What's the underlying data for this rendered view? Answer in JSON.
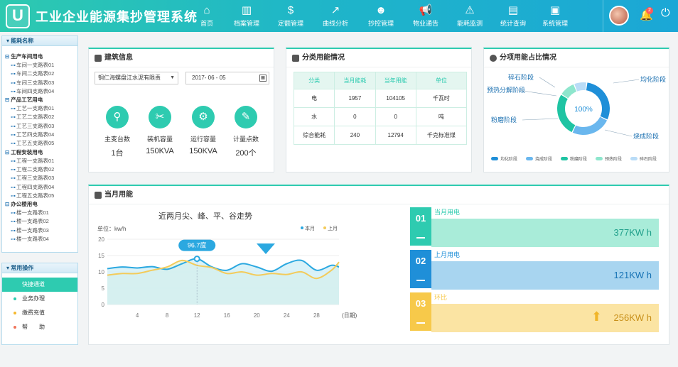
{
  "header": {
    "logo_letter": "U",
    "title": "工业企业能源集抄管理系统",
    "nav": [
      {
        "label": "首页",
        "icon": "home-icon",
        "glyph": "⌂"
      },
      {
        "label": "档案管理",
        "icon": "books-icon",
        "glyph": "▥"
      },
      {
        "label": "定额管理",
        "icon": "dollar-icon",
        "glyph": "$"
      },
      {
        "label": "曲线分析",
        "icon": "line-chart-icon",
        "glyph": "↗"
      },
      {
        "label": "抄控管理",
        "icon": "user-gear-icon",
        "glyph": "☻"
      },
      {
        "label": "物业通告",
        "icon": "megaphone-icon",
        "glyph": "📢"
      },
      {
        "label": "能耗监测",
        "icon": "alarm-icon",
        "glyph": "⚠"
      },
      {
        "label": "统计查询",
        "icon": "briefcase-icon",
        "glyph": "▤"
      },
      {
        "label": "系统管理",
        "icon": "monitor-icon",
        "glyph": "▣"
      }
    ],
    "notification_count": "2"
  },
  "sidebar": {
    "title": "能耗名称",
    "groups": [
      {
        "name": "生产车间用电",
        "items": [
          "车间一支路表01",
          "车间二支路表02",
          "车间三支路表03",
          "车间四支路表04"
        ]
      },
      {
        "name": "产品工艺用电",
        "items": [
          "工艺一支路表01",
          "工艺二支路表02",
          "工艺三支路表03",
          "工艺四支路表04",
          "工艺五支路表05"
        ]
      },
      {
        "name": "工程安装用电",
        "items": [
          "工程一支路表01",
          "工程二支路表02",
          "工程三支路表03",
          "工程四支路表04",
          "工程五支路表05"
        ]
      },
      {
        "name": "办公楼用电",
        "items": [
          "楼一支路表01",
          "楼一支路表02",
          "楼一支路表03",
          "楼一支路表04"
        ]
      }
    ],
    "ops_title": "常用操作",
    "ops": [
      {
        "label": "快捷通道",
        "active": true,
        "color": "#2ecbb0"
      },
      {
        "label": "业务办理",
        "active": false,
        "color": "#2ecbb0"
      },
      {
        "label": "缴费充值",
        "active": false,
        "color": "#f5b82e"
      },
      {
        "label": "帮　　助",
        "active": false,
        "color": "#f0745a"
      }
    ]
  },
  "building": {
    "title": "建筑信息",
    "company": "铜仁海螺盘江水泥有限责",
    "date": "2017- 06 - 05",
    "stats": [
      {
        "label": "主变台数",
        "value": "1台",
        "icon": "search-icon",
        "glyph": "⚲"
      },
      {
        "label": "装机容量",
        "value": "150KVA",
        "icon": "tools-icon",
        "glyph": "✂"
      },
      {
        "label": "运行容量",
        "value": "150KVA",
        "icon": "gears-icon",
        "glyph": "⚙"
      },
      {
        "label": "计量点数",
        "value": "200个",
        "icon": "edit-icon",
        "glyph": "✎"
      }
    ]
  },
  "category": {
    "title": "分类用能情况",
    "headers": [
      "分类",
      "当月能耗",
      "当年用能",
      "单位"
    ],
    "rows": [
      [
        "电",
        "1957",
        "104105",
        "千瓦时"
      ],
      [
        "水",
        "0",
        "0",
        "吨"
      ],
      [
        "综合能耗",
        "240",
        "12794",
        "千克标准煤"
      ]
    ]
  },
  "share": {
    "title": "分项用能占比情况",
    "center_label": "100%",
    "labels": [
      "碎石阶段",
      "均化阶段",
      "预热分解阶段",
      "粉磨阶段",
      "烧成阶段"
    ],
    "legend": [
      {
        "name": "均化阶段",
        "color": "#1f8fd8"
      },
      {
        "name": "烧成阶段",
        "color": "#6ab7ee"
      },
      {
        "name": "粉磨阶段",
        "color": "#1fc4a3"
      },
      {
        "name": "预热阶段",
        "color": "#8ee6cd"
      },
      {
        "name": "碎石阶段",
        "color": "#b9dcf7"
      }
    ],
    "segments": [
      {
        "name": "均化阶段",
        "value": 30,
        "color": "#1f8fd8"
      },
      {
        "name": "烧成阶段",
        "value": 25,
        "color": "#6ab7ee"
      },
      {
        "name": "粉磨阶段",
        "value": 27,
        "color": "#1fc4a3"
      },
      {
        "name": "预热分解阶段",
        "value": 10,
        "color": "#8ee6cd"
      },
      {
        "name": "碎石阶段",
        "value": 8,
        "color": "#b9dcf7"
      }
    ]
  },
  "monthly": {
    "title": "当月用能",
    "cards": [
      {
        "num": "01",
        "label": "当月用电",
        "value": "377KW  h",
        "color": "#2ecbb0",
        "bg": "#a9ecd9",
        "text": "#1f9f8a"
      },
      {
        "num": "02",
        "label": "上月用电",
        "value": "121KW  h",
        "color": "#1f8fd8",
        "bg": "#a8d5f0",
        "text": "#1773b5"
      },
      {
        "num": "03",
        "label": "环比",
        "value": "256KW  h",
        "color": "#f7c94a",
        "bg": "#fbe4a3",
        "text": "#c8901a"
      }
    ]
  },
  "chart_data": {
    "type": "line",
    "title": "近两月尖、峰、平、谷走势",
    "ylabel": "单位：kw/h",
    "xlabel": "(日期)",
    "x_ticks": [
      "4",
      "8",
      "12",
      "16",
      "20",
      "24",
      "28"
    ],
    "y_ticks": [
      "0",
      "5",
      "10",
      "15",
      "20"
    ],
    "ylim": [
      0,
      20
    ],
    "xlim": [
      0,
      31
    ],
    "legend": [
      "本月",
      "上月"
    ],
    "tooltip": "96.7度",
    "series": [
      {
        "name": "本月",
        "color": "#2ba8e0",
        "x": [
          0,
          2,
          4,
          6,
          8,
          10,
          12,
          14,
          16,
          18,
          20,
          22,
          24,
          26,
          28,
          30,
          31
        ],
        "values": [
          11,
          11.5,
          11.2,
          11.6,
          10.8,
          12.5,
          14,
          11.5,
          10.5,
          12.5,
          11.5,
          10.2,
          12.5,
          13.5,
          10.5,
          12,
          11.5
        ]
      },
      {
        "name": "上月",
        "color": "#f3cb5a",
        "x": [
          0,
          2,
          4,
          6,
          8,
          10,
          12,
          14,
          16,
          18,
          20,
          22,
          24,
          26,
          28,
          30,
          31
        ],
        "values": [
          9,
          9.5,
          9.5,
          10.5,
          11.5,
          13.5,
          12,
          11.3,
          9.5,
          10,
          9,
          9.5,
          9.2,
          10,
          8,
          10.5,
          13
        ]
      }
    ]
  }
}
